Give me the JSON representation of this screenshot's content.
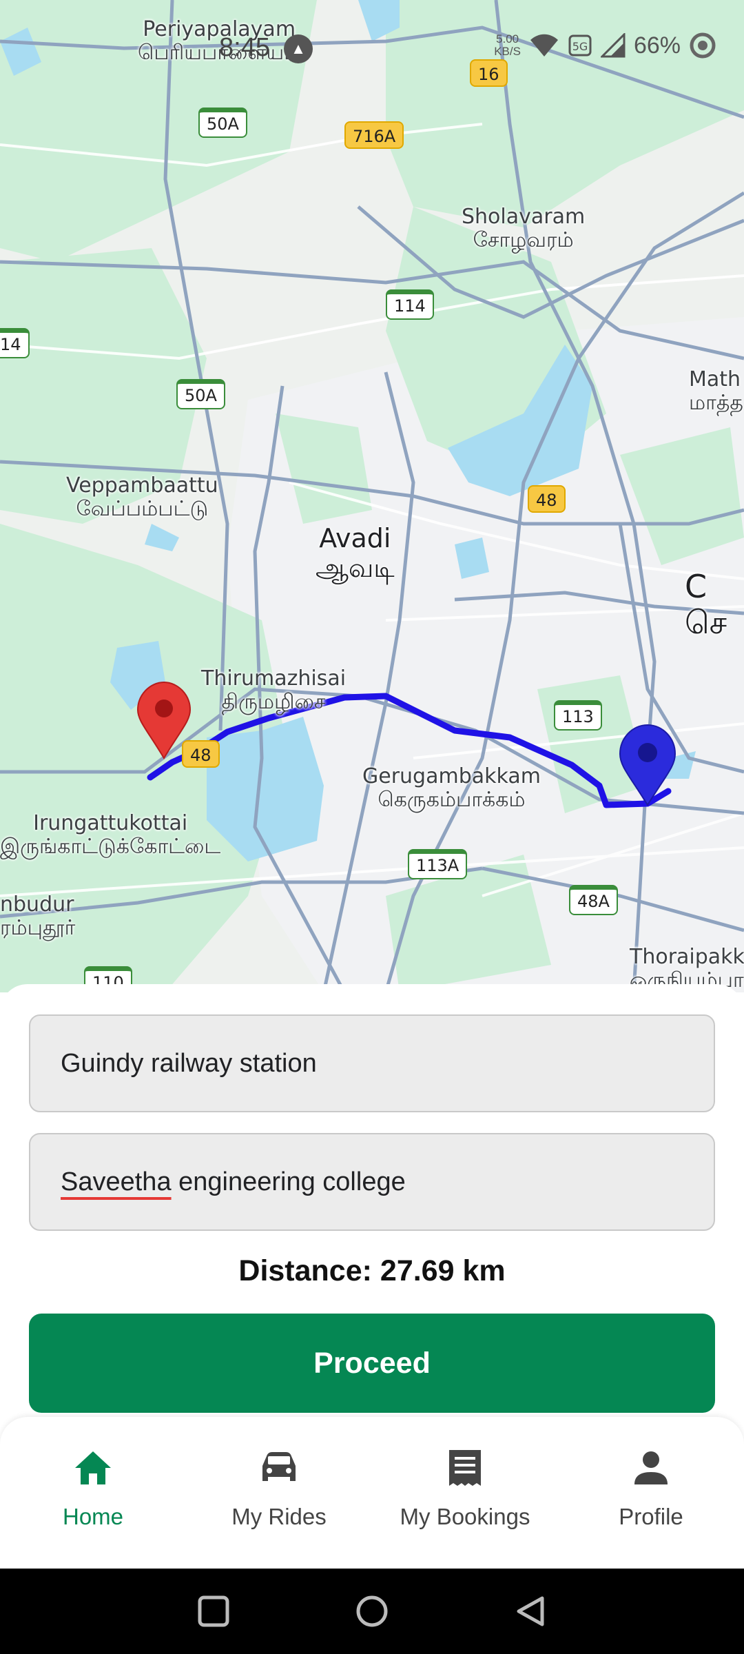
{
  "status_bar": {
    "time": "8:45",
    "network_speed_value": "5.00",
    "network_speed_unit": "KB/S",
    "battery": "66%"
  },
  "map": {
    "places": [
      {
        "en": "Periyapalayam",
        "ta": "பெரியபாளையம்"
      },
      {
        "en": "Sholavaram",
        "ta": "சோழவரம்"
      },
      {
        "en": "Veppambaattu",
        "ta": "வேப்பம்பட்டு"
      },
      {
        "en": "Avadi",
        "ta": "ஆவடி"
      },
      {
        "en": "Thirumazhisai",
        "ta": "திருமழிசை"
      },
      {
        "en": "Gerugambakkam",
        "ta": "கெருகம்பாக்கம்"
      },
      {
        "en": "Irungattukottai",
        "ta": "இருங்காட்டுக்கோட்டை"
      },
      {
        "en": "nbudur",
        "ta": "ரம்புதூர்"
      },
      {
        "en": "Thoraipakk",
        "ta": "ஒருநியம்பாக்க"
      },
      {
        "en": "Math",
        "ta": "மாத்த"
      },
      {
        "en": "C",
        "ta": "செ"
      }
    ],
    "road_shields": [
      "16",
      "50A",
      "716A",
      "114",
      "14",
      "50A",
      "48",
      "113",
      "48",
      "113A",
      "48A",
      "110"
    ],
    "route_color": "#1f12e6",
    "origin_pin_color": "#2b2bdc",
    "destination_pin_color": "#e53935"
  },
  "form": {
    "pickup_value": "Guindy railway station",
    "drop_value_misspelled": "Saveetha",
    "drop_value_rest": " engineering college"
  },
  "distance_text": "Distance: 27.69 km",
  "proceed_label": "Proceed",
  "accent_color": "#058753",
  "bottom_nav": {
    "items": [
      {
        "label": "Home",
        "icon": "home-icon",
        "active": true
      },
      {
        "label": "My Rides",
        "icon": "car-icon",
        "active": false
      },
      {
        "label": "My Bookings",
        "icon": "receipt-icon",
        "active": false
      },
      {
        "label": "Profile",
        "icon": "person-icon",
        "active": false
      }
    ]
  }
}
